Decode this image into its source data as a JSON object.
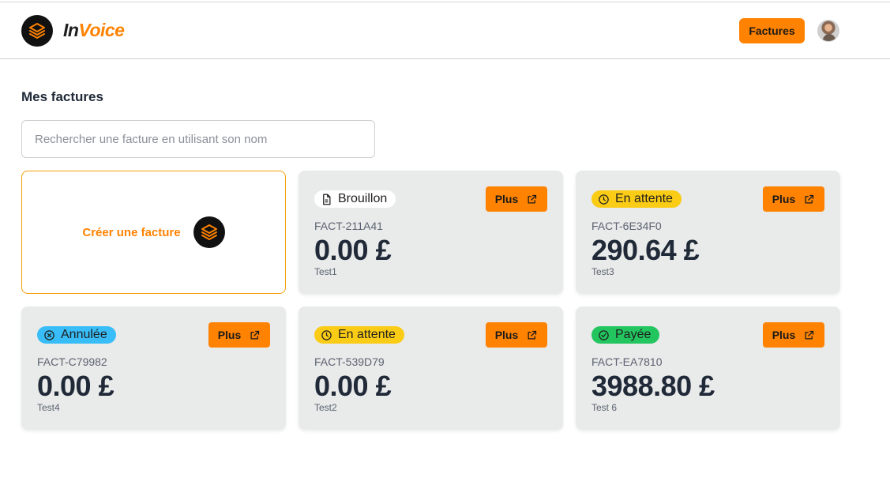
{
  "header": {
    "brand_part1": "In",
    "brand_part2": "Voice",
    "nav_button": "Factures"
  },
  "page": {
    "title": "Mes factures",
    "search_placeholder": "Rechercher une facture en utilisant son nom",
    "create_label": "Créer une facture"
  },
  "colors": {
    "accent": "#ff8200",
    "card_bg": "#e9eaea",
    "draft": "#ffffff",
    "pending": "#facc15",
    "cancelled": "#38bdf8",
    "paid": "#22c55e"
  },
  "invoices": [
    {
      "status": "Brouillon",
      "status_icon": "document-icon",
      "code": "FACT-211A41",
      "amount": "0.00 £",
      "client": "Test1",
      "action": "Plus"
    },
    {
      "status": "En attente",
      "status_icon": "clock-icon",
      "code": "FACT-6E34F0",
      "amount": "290.64 £",
      "client": "Test3",
      "action": "Plus"
    },
    {
      "status": "Annulée",
      "status_icon": "x-circle-icon",
      "code": "FACT-C79982",
      "amount": "0.00 £",
      "client": "Test4",
      "action": "Plus"
    },
    {
      "status": "En attente",
      "status_icon": "clock-icon",
      "code": "FACT-539D79",
      "amount": "0.00 £",
      "client": "Test2",
      "action": "Plus"
    },
    {
      "status": "Payée",
      "status_icon": "check-circle-icon",
      "code": "FACT-EA7810",
      "amount": "3988.80 £",
      "client": "Test 6",
      "action": "Plus"
    }
  ]
}
